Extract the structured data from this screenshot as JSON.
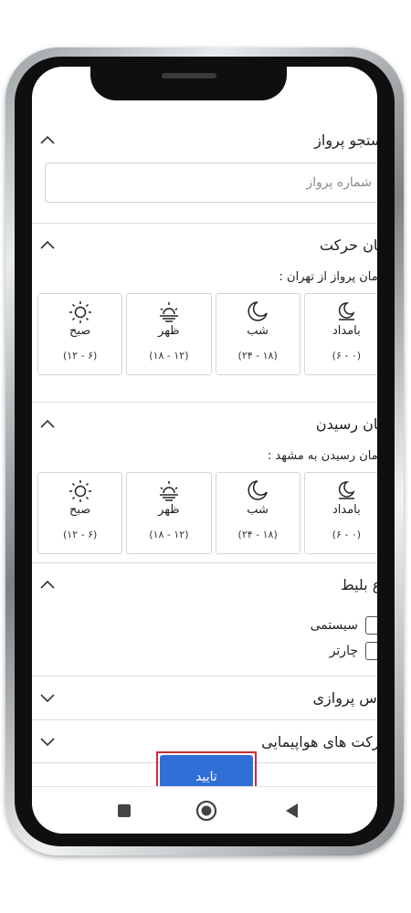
{
  "flight_search": {
    "title": "جستجو پرواز",
    "placeholder": "شماره پرواز",
    "value": ""
  },
  "departure": {
    "title": "زمان حرکت",
    "subtitle": "زمان پرواز از تهران :",
    "tiles": [
      {
        "icon": "sunrise-moon-icon",
        "label": "بامداد",
        "range": "(۰ - ۶)"
      },
      {
        "icon": "moon-icon",
        "label": "شب",
        "range": "(۱۸ - ۲۴)"
      },
      {
        "icon": "sunset-icon",
        "label": "ظهر",
        "range": "(۱۲ - ۱۸)"
      },
      {
        "icon": "sun-icon",
        "label": "صبح",
        "range": "(۶ - ۱۲)"
      }
    ]
  },
  "arrival": {
    "title": "زمان رسیدن",
    "subtitle": "زمان رسیدن به مشهد :",
    "tiles": [
      {
        "icon": "sunrise-moon-icon",
        "label": "بامداد",
        "range": "(۰ - ۶)"
      },
      {
        "icon": "moon-icon",
        "label": "شب",
        "range": "(۱۸ - ۲۴)"
      },
      {
        "icon": "sunset-icon",
        "label": "ظهر",
        "range": "(۱۲ - ۱۸)"
      },
      {
        "icon": "sun-icon",
        "label": "صبح",
        "range": "(۶ - ۱۲)"
      }
    ]
  },
  "ticket_type": {
    "title": "نوع بلیط",
    "options": [
      {
        "label": "سیستمی",
        "checked": false
      },
      {
        "label": "چارتر",
        "checked": false
      }
    ]
  },
  "flight_class": {
    "title": "کلاس پروازی"
  },
  "airlines": {
    "title": "شرکت های هواپیمایی"
  },
  "confirm_label": "تایید",
  "colors": {
    "accent": "#2f6fd6",
    "highlight": "#d12b3a"
  }
}
